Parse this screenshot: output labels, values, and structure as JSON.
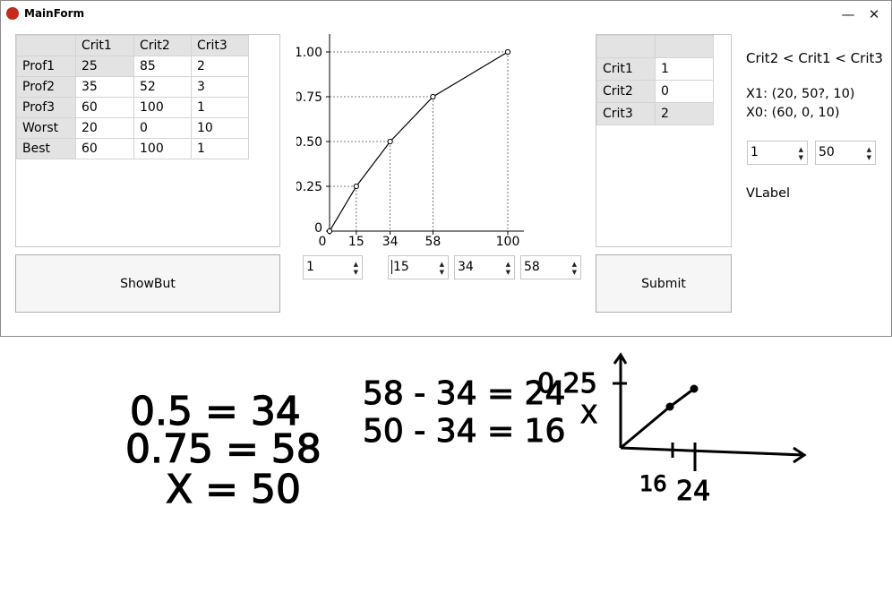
{
  "window": {
    "title": "MainForm",
    "minimize_glyph": "—",
    "close_glyph": "✕",
    "accent": "#c42b1c"
  },
  "left_table": {
    "headers": [
      "",
      "Crit1",
      "Crit2",
      "Crit3"
    ],
    "rows": [
      {
        "label": "Prof1",
        "cells": [
          "25",
          "85",
          "2"
        ]
      },
      {
        "label": "Prof2",
        "cells": [
          "35",
          "52",
          "3"
        ]
      },
      {
        "label": "Prof3",
        "cells": [
          "60",
          "100",
          "1"
        ]
      },
      {
        "label": "Worst",
        "cells": [
          "20",
          "0",
          "10"
        ]
      },
      {
        "label": "Best",
        "cells": [
          "60",
          "100",
          "1"
        ]
      }
    ]
  },
  "show_button": "ShowBut",
  "chart_data": {
    "type": "line",
    "x": [
      0,
      15,
      34,
      58,
      100
    ],
    "y": [
      0,
      0.25,
      0.5,
      0.75,
      1.0
    ],
    "x_tick_labels": [
      "0",
      "15",
      "34",
      "58",
      "100"
    ],
    "y_tick_labels": [
      "0",
      "0.25",
      "0.50",
      "0.75",
      "1.00"
    ],
    "xlim": [
      0,
      100
    ],
    "ylim": [
      0,
      1
    ],
    "grid": "dashed guide lines to each point",
    "title": "",
    "xlabel": "",
    "ylabel": ""
  },
  "spinners_chart": [
    "1",
    "15",
    "34",
    "58"
  ],
  "right_table": {
    "headers": [
      "",
      ""
    ],
    "rows": [
      {
        "label": "Crit1",
        "value": "1"
      },
      {
        "label": "Crit2",
        "value": "0"
      },
      {
        "label": "Crit3",
        "value": "2"
      }
    ]
  },
  "submit_button": "Submit",
  "info": {
    "order": "Crit2 < Crit1 < Crit3",
    "x1": "X1: (20, 50?, 10)",
    "x0": "X0: (60, 0, 10)",
    "spinner_a": "1",
    "spinner_b": "50",
    "vlabel": "VLabel"
  },
  "scribbles": {
    "lines": [
      "0.5 = 34",
      "0.75 = 58",
      "X = 50",
      "58 - 34 = 24",
      "50 - 34 = 16",
      "0.25",
      "X",
      "16",
      "24"
    ]
  }
}
